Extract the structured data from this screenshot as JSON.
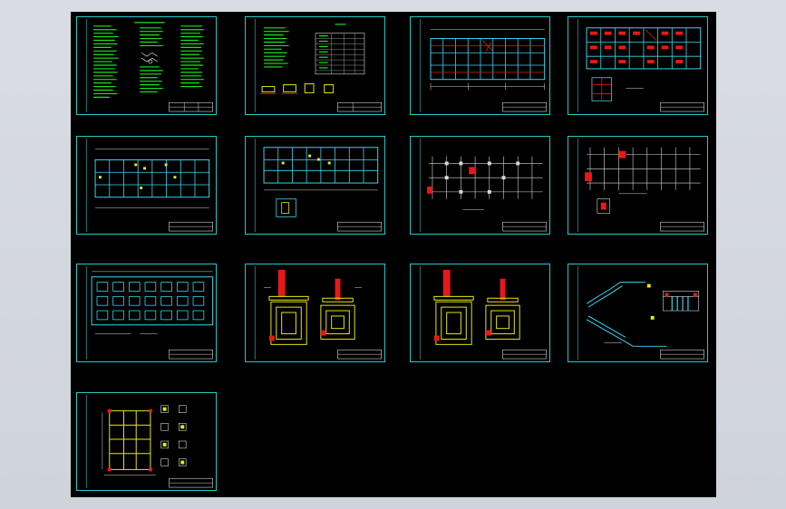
{
  "viewer": {
    "sheet_count": 13,
    "colors": {
      "background": "#000000",
      "frame": "#25c7c7",
      "green": "#19e619",
      "yellow": "#e6e619",
      "red": "#e61919",
      "white": "#d8d8d8",
      "cyan": "#3ad8f0"
    }
  },
  "sheets": [
    {
      "id": "sheet-01",
      "kind": "notes"
    },
    {
      "id": "sheet-02",
      "kind": "notes-table"
    },
    {
      "id": "sheet-03",
      "kind": "plan-grid"
    },
    {
      "id": "sheet-04",
      "kind": "plan-grid-red"
    },
    {
      "id": "sheet-05",
      "kind": "plan-beams"
    },
    {
      "id": "sheet-06",
      "kind": "plan-beams-detail"
    },
    {
      "id": "sheet-07",
      "kind": "plan-columns"
    },
    {
      "id": "sheet-08",
      "kind": "plan-columns-detail"
    },
    {
      "id": "sheet-09",
      "kind": "foundation-plan"
    },
    {
      "id": "sheet-10",
      "kind": "footing-detail"
    },
    {
      "id": "sheet-11",
      "kind": "footing-detail"
    },
    {
      "id": "sheet-12",
      "kind": "stair-detail"
    },
    {
      "id": "sheet-13",
      "kind": "section-detail"
    }
  ]
}
